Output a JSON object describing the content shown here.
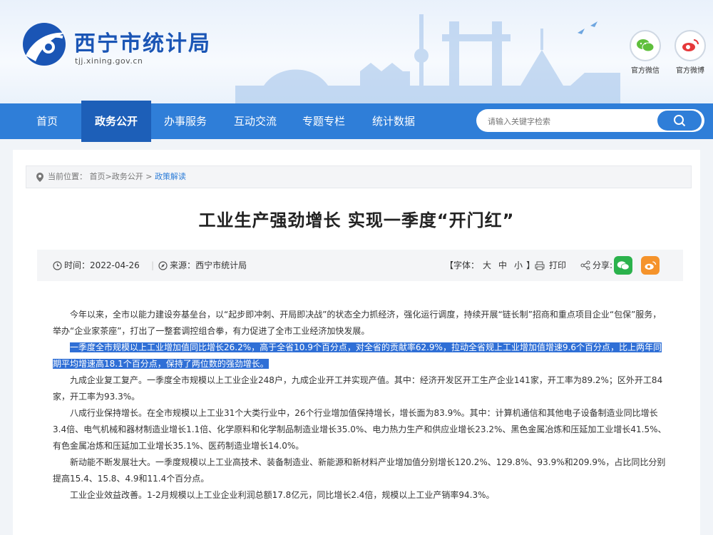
{
  "site": {
    "title": "西宁市统计局",
    "url": "tjj.xining.gov.cn"
  },
  "social": [
    {
      "label": "官方微信",
      "icon": "wechat-icon",
      "color": "#5fbf3c"
    },
    {
      "label": "官方微博",
      "icon": "weibo-icon",
      "color": "#e6383a"
    }
  ],
  "nav": {
    "items": [
      "首页",
      "政务公开",
      "办事服务",
      "互动交流",
      "专题专栏",
      "统计数据"
    ],
    "active": "政务公开"
  },
  "search": {
    "placeholder": "请输入关键字检索"
  },
  "breadcrumb": {
    "prefix": "当前位置：",
    "path": "首页>政务公开 > ",
    "current": "政策解读"
  },
  "article": {
    "title": "工业生产强劲增长 实现一季度“开门红”",
    "time_label": "时间：",
    "time": "2022-04-26",
    "source_label": "来源：",
    "source": "西宁市统计局",
    "font_label": "【字体：",
    "font_large": "大",
    "font_medium": "中",
    "font_small": "小",
    "font_close": "】",
    "print": "打印",
    "share": "分享:",
    "paragraphs": [
      "今年以来，全市以能力建设夯基垒台，以“起步即冲刺、开局即决战”的状态全力抓经济，强化运行调度，持续开展“链长制”招商和重点项目企业“包保”服务，举办“企业家茶座”，打出了一整套调控组合拳，有力促进了全市工业经济加快发展。",
      "一季度全市规模以上工业增加值同比增长26.2%，高于全省10.9个百分点，对全省的贡献率62.9%，拉动全省规上工业增加值增速9.6个百分点，比上两年同期平均增速高18.1个百分点，保持了两位数的强劲增长。",
      "九成企业复工复产。一季度全市规模以上工业企业248户，九成企业开工并实现产值。其中：经济开发区开工生产企业141家，开工率为89.2%；区外开工84家，开工率为93.3%。",
      "八成行业保持增长。在全市规模以上工业31个大类行业中，26个行业增加值保持增长，增长面为83.9%。其中：计算机通信和其他电子设备制造业同比增长3.4倍、电气机械和器材制造业增长1.1倍、化学原料和化学制品制造业增长35.0%、电力热力生产和供应业增长23.2%、黑色金属冶炼和压延加工业增长41.5%、有色金属冶炼和压延加工业增长35.1%、医药制造业增长14.0%。",
      "新动能不断发展壮大。一季度规模以上工业高技术、装备制造业、新能源和新材料产业增加值分别增长120.2%、129.8%、93.9%和209.9%，占比同比分别提高15.4、15.8、4.9和11.4个百分点。",
      "工业企业效益改善。1-2月规模以上工业企业利润总额17.8亿元，同比增长2.4倍，规模以上工业产销率94.3%。"
    ]
  },
  "colors": {
    "brand": "#1a55b5",
    "nav": "#2f7ed8",
    "nav_active": "#1d5fb8",
    "highlight": "#2f6fd6"
  }
}
